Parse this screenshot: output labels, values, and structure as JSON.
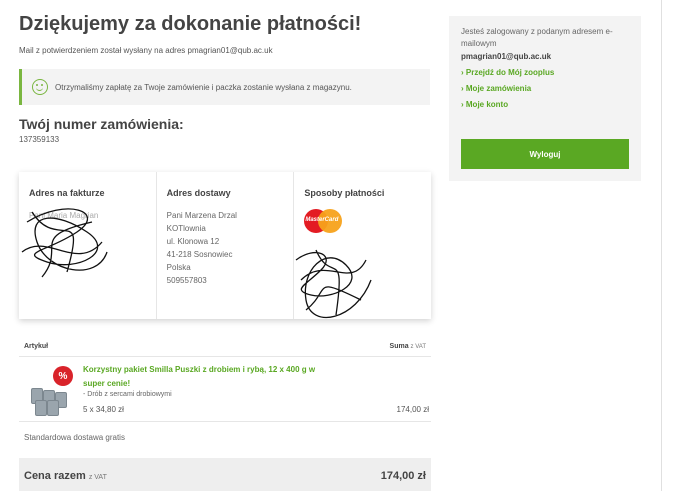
{
  "header": {
    "title": "Dziękujemy za dokonanie płatności!",
    "mail_note": "Mail z potwierdzeniem został wysłany na adres pmagrian01@qub.ac.uk"
  },
  "success": {
    "icon": "smile-icon",
    "message": "Otrzymaliśmy zapłatę za Twoje zamówienie i paczka zostanie wysłana z magazynu."
  },
  "order": {
    "label": "Twój numer zamówienia:",
    "number": "137359133"
  },
  "cards": {
    "billing": {
      "title": "Adres na fakturze",
      "lines": [
        "Pani Maria Magrian",
        "",
        "",
        "",
        "",
        ""
      ]
    },
    "shipping": {
      "title": "Adres dostawy",
      "lines": [
        "Pani Marzena Drzal",
        "KOTlownia",
        "ul. Klonowa 12",
        "41-218 Sosnowiec",
        "Polska",
        "509557803"
      ]
    },
    "payment": {
      "title": "Sposoby płatności",
      "logo_text": "MasterCard"
    }
  },
  "table": {
    "col_item": "Artykuł",
    "col_sum": "Suma",
    "col_sum_vat": "z VAT"
  },
  "product": {
    "badge": "%",
    "name": "Korzystny pakiet Smilla Puszki z drobiem i rybą, 12 x 400 g w super cenie!",
    "variant": "- Drób z sercami drobiowymi",
    "qty_price": "5 x 34,80 zł",
    "total": "174,00 zł"
  },
  "shipping_note": "Standardowa dostawa gratis",
  "totals": {
    "label": "Cena razem",
    "vat": "z VAT",
    "value": "174,00 zł"
  },
  "sidebar": {
    "logged_in_text": "Jesteś zalogowany z podanym adresem e-mailowym",
    "email": "pmagrian01@qub.ac.uk",
    "links": [
      "Przejdź do Mój zooplus",
      "Moje zamówienia",
      "Moje konto"
    ],
    "logout_label": "Wyloguj"
  },
  "colors": {
    "accent_green": "#5aa823",
    "badge_red": "#d9232a"
  }
}
